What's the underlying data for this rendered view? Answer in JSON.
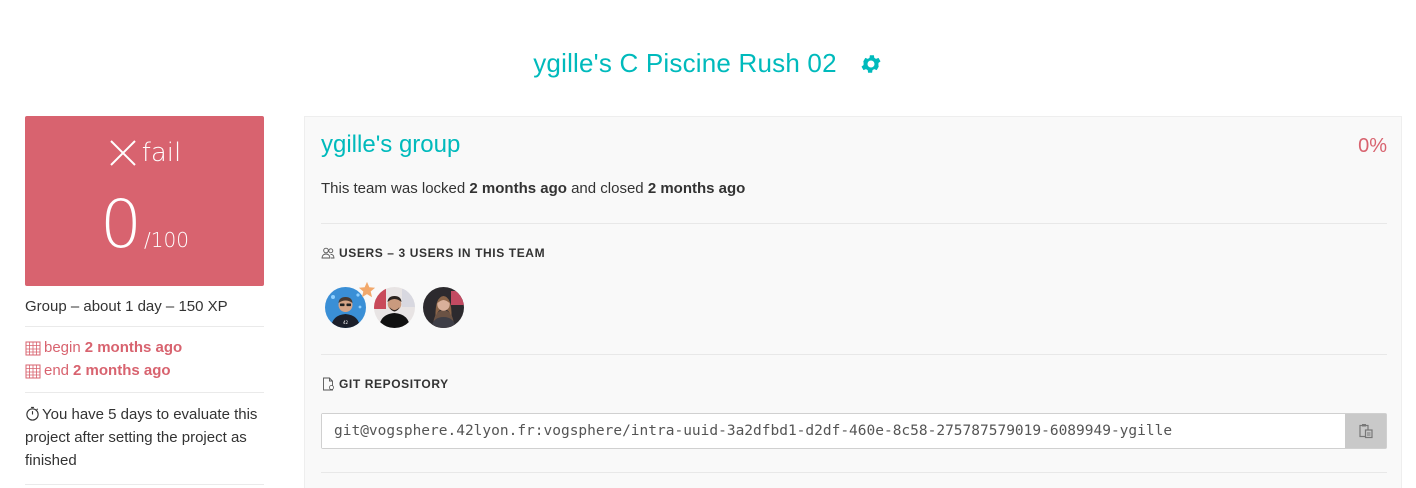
{
  "header": {
    "title": "ygille's C Piscine Rush 02",
    "settings_icon": "gear-icon"
  },
  "score_card": {
    "status_icon": "close-icon",
    "status": "fail",
    "score": "0",
    "max": "/100",
    "color": "#d8636f"
  },
  "summary": {
    "info": "Group – about 1 day – 150 XP",
    "begin_label": "begin",
    "begin_value": "2 months ago",
    "end_label": "end",
    "end_value": "2 months ago",
    "evaluation_note": "You have 5 days to evaluate this project after setting the project as finished"
  },
  "team": {
    "name": "ygille's group",
    "percent": "0%",
    "lock_prefix": "This team was locked",
    "locked_when": "2 months ago",
    "lock_middle": "and closed",
    "closed_when": "2 months ago",
    "users_title": "USERS – 3 USERS IN THIS TEAM",
    "users": [
      {
        "role": "leader",
        "badge_icon": "star-icon"
      },
      {
        "role": "member"
      },
      {
        "role": "member"
      }
    ],
    "git_title": "GIT REPOSITORY",
    "repo_url": "git@vogsphere.42lyon.fr:vogsphere/intra-uuid-3a2dfbd1-d2df-460e-8c58-275787579019-6089949-ygille",
    "copy_icon": "clipboard-icon"
  },
  "colors": {
    "accent": "#00babc",
    "fail": "#d8636f"
  }
}
